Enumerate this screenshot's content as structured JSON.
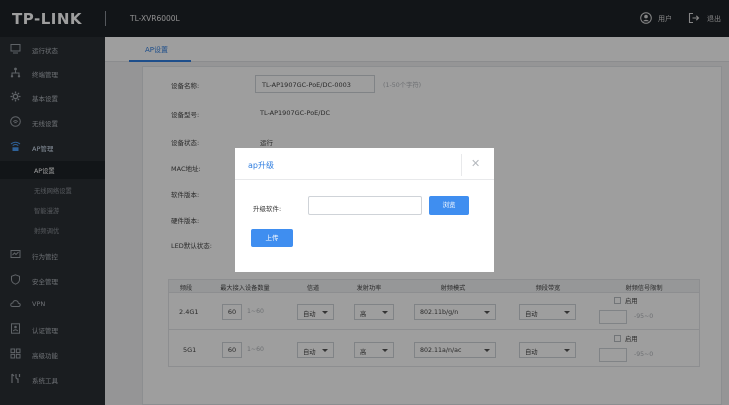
{
  "header": {
    "logo": "TP-LINK",
    "model": "TL-XVR6000L",
    "user_label": "用户",
    "logout_label": "退出"
  },
  "sidebar": {
    "items": [
      {
        "label": "运行状态",
        "icon": "monitor-icon"
      },
      {
        "label": "终端管理",
        "icon": "terminal-tree-icon"
      },
      {
        "label": "基本设置",
        "icon": "gear-icon"
      },
      {
        "label": "无线设置",
        "icon": "wireless-icon"
      },
      {
        "label": "AP管理",
        "icon": "ap-icon"
      }
    ],
    "subitems": [
      {
        "label": "AP设置"
      },
      {
        "label": "无线网络设置"
      },
      {
        "label": "智能漫游"
      },
      {
        "label": "射频调优"
      }
    ],
    "items_after": [
      {
        "label": "行为管控",
        "icon": "behavior-icon"
      },
      {
        "label": "安全管理",
        "icon": "shield-icon"
      },
      {
        "label": "VPN",
        "icon": "cloud-icon"
      },
      {
        "label": "认证管理",
        "icon": "auth-icon"
      },
      {
        "label": "高级功能",
        "icon": "grid-icon"
      },
      {
        "label": "系统工具",
        "icon": "tools-icon"
      }
    ]
  },
  "main": {
    "tab": "AP设置",
    "form": {
      "device_name_label": "设备名称:",
      "device_name_value": "TL-AP1907GC-PoE/DC-0003",
      "device_name_hint": "(1-50个字符)",
      "device_model_label": "设备型号:",
      "device_model_value": "TL-AP1907GC-PoE/DC",
      "device_status_label": "设备状态:",
      "device_status_value": "运行",
      "mac_label": "MAC地址:",
      "software_label": "软件版本:",
      "hardware_label": "硬件版本:",
      "led_label": "LED默认状态:"
    },
    "table": {
      "headers": [
        "频段",
        "最大接入设备数量",
        "信道",
        "发射功率",
        "射频模式",
        "频段带宽",
        "射频信号限制"
      ],
      "rows": [
        {
          "band": "2.4G1",
          "max": "60",
          "range": "1~60",
          "channel": "自动",
          "power": "高",
          "mode": "802.11b/g/n",
          "bandwidth": "自动",
          "enable": "启用",
          "signal_range": "-95~0"
        },
        {
          "band": "5G1",
          "max": "60",
          "range": "1~60",
          "channel": "自动",
          "power": "高",
          "mode": "802.11a/n/ac",
          "bandwidth": "自动",
          "enable": "启用",
          "signal_range": "-95~0"
        }
      ]
    }
  },
  "modal": {
    "title": "ap升级",
    "file_label": "升级软件:",
    "file_value": "",
    "browse_label": "浏览",
    "upload_label": "上传"
  },
  "colors": {
    "accent": "#3f8ef0",
    "topbar": "#1e2228",
    "sidebar": "#2b2f35"
  }
}
